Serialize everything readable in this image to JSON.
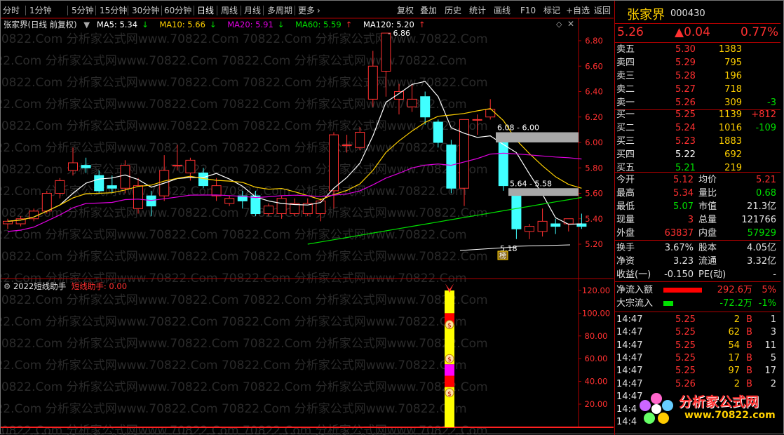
{
  "toolbar": {
    "periods": [
      "分时",
      "1分钟",
      "5分钟",
      "15分钟",
      "30分钟",
      "60分钟",
      "日线",
      "周线",
      "月线",
      "多周期",
      "更多"
    ],
    "active_period": "日线",
    "actions": [
      "复权",
      "叠加",
      "历史",
      "统计",
      "画线",
      "F10",
      "标记",
      "+自选",
      "返回"
    ]
  },
  "main_chart": {
    "title": "张家界(日线 前复权)",
    "ma": [
      {
        "label": "MA5: 5.34",
        "arrow": "↓",
        "color": "#ffffff"
      },
      {
        "label": "MA10: 5.66",
        "arrow": "↓",
        "color": "#ffd000"
      },
      {
        "label": "MA20: 5.91",
        "arrow": "↓",
        "color": "#e000e0"
      },
      {
        "label": "MA60: 5.59",
        "arrow": "↑",
        "color": "#00e000"
      },
      {
        "label": "MA120: 5.20",
        "arrow": "↑",
        "color": "#ffffff"
      }
    ],
    "y_ticks": [
      "6.80",
      "6.60",
      "6.40",
      "6.20",
      "6.00",
      "5.80",
      "5.60",
      "5.40",
      "5.20"
    ],
    "annotations": {
      "high": "6.86",
      "zone1": "6.08 - 6.00",
      "zone2": "5.64 - 5.58",
      "low": "5.18",
      "badge": "榜"
    }
  },
  "sub_chart": {
    "title": "2022短线助手",
    "indicator": "短线助手: 0.00",
    "y_ticks": [
      "120.00",
      "100.00",
      "80.00",
      "60.00",
      "40.00",
      "20.00"
    ]
  },
  "watermark": "70822.Com 分析家公式网www.70822.Com",
  "stock": {
    "name": "张家界",
    "code": "000430",
    "price": "5.26",
    "change": "▲0.04",
    "pct": "0.77%"
  },
  "order_book": {
    "asks": [
      {
        "label": "卖五",
        "price": "5.30",
        "vol": "1383",
        "chg": ""
      },
      {
        "label": "卖四",
        "price": "5.29",
        "vol": "795",
        "chg": ""
      },
      {
        "label": "卖三",
        "price": "5.28",
        "vol": "196",
        "chg": ""
      },
      {
        "label": "卖二",
        "price": "5.27",
        "vol": "718",
        "chg": ""
      },
      {
        "label": "卖一",
        "price": "5.26",
        "vol": "309",
        "chg": "-3"
      }
    ],
    "bids": [
      {
        "label": "买一",
        "price": "5.25",
        "vol": "1139",
        "chg": "+812"
      },
      {
        "label": "买二",
        "price": "5.24",
        "vol": "1016",
        "chg": "-109"
      },
      {
        "label": "买三",
        "price": "5.23",
        "vol": "1883",
        "chg": ""
      },
      {
        "label": "买四",
        "price": "5.22",
        "vol": "692",
        "chg": ""
      },
      {
        "label": "买五",
        "price": "5.21",
        "vol": "219",
        "chg": ""
      }
    ]
  },
  "stats": [
    {
      "l1": "今开",
      "v1": "5.12",
      "l2": "均价",
      "v2": "5.21"
    },
    {
      "l1": "最高",
      "v1": "5.34",
      "l2": "量比",
      "v2": "0.68"
    },
    {
      "l1": "最低",
      "v1": "5.07",
      "l2": "市值",
      "v2": "21.3亿"
    },
    {
      "l1": "现量",
      "v1": "3",
      "l2": "总量",
      "v2": "121766"
    },
    {
      "l1": "外盘",
      "v1": "63837",
      "l2": "内盘",
      "v2": "57929"
    }
  ],
  "stats2": [
    {
      "l1": "换手",
      "v1": "3.67%",
      "l2": "股本",
      "v2": "4.05亿"
    },
    {
      "l1": "净资",
      "v1": "3.23",
      "l2": "流通",
      "v2": "3.32亿"
    },
    {
      "l1": "收益(一)",
      "v1": "-0.150",
      "l2": "PE(动)",
      "v2": "-"
    }
  ],
  "flows": [
    {
      "label": "净流入额",
      "value": "292.6万",
      "pct": "5%"
    },
    {
      "label": "大宗流入",
      "value": "-72.2万",
      "pct": "-1%"
    }
  ],
  "ticks": [
    {
      "time": "14:47",
      "price": "5.25",
      "vol": "2",
      "side": "B",
      "n": "1"
    },
    {
      "time": "14:47",
      "price": "5.25",
      "vol": "62",
      "side": "B",
      "n": "3"
    },
    {
      "time": "14:47",
      "price": "5.25",
      "vol": "54",
      "side": "B",
      "n": "11"
    },
    {
      "time": "14:47",
      "price": "5.25",
      "vol": "17",
      "side": "B",
      "n": "5"
    },
    {
      "time": "14:47",
      "price": "5.25",
      "vol": "97",
      "side": "B",
      "n": "17"
    },
    {
      "time": "14:47",
      "price": "5.26",
      "vol": "2",
      "side": "B",
      "n": "2"
    },
    {
      "time": "14:47",
      "price": "",
      "vol": "",
      "side": "",
      "n": ""
    },
    {
      "time": "14:4",
      "price": "",
      "vol": "",
      "side": "",
      "n": ""
    },
    {
      "time": "14:4",
      "price": "",
      "vol": "",
      "side": "",
      "n": ""
    }
  ],
  "logo": {
    "name": "分析家公式网",
    "url": "www.70822.com"
  },
  "candles": [
    [
      5.36,
      5.38,
      5.32,
      5.4
    ],
    [
      5.36,
      5.4,
      5.34,
      5.42
    ],
    [
      5.4,
      5.46,
      5.38,
      5.48
    ],
    [
      5.46,
      5.6,
      5.44,
      5.62
    ],
    [
      5.6,
      5.7,
      5.56,
      5.72
    ],
    [
      5.78,
      5.84,
      5.74,
      5.96
    ],
    [
      5.82,
      5.8,
      5.76,
      5.88
    ],
    [
      5.74,
      5.62,
      5.6,
      5.78
    ],
    [
      5.66,
      5.64,
      5.6,
      5.74
    ],
    [
      5.64,
      5.82,
      5.6,
      5.86
    ],
    [
      5.48,
      5.66,
      5.44,
      5.72
    ],
    [
      5.58,
      5.5,
      5.42,
      5.62
    ],
    [
      5.58,
      5.78,
      5.54,
      5.9
    ],
    [
      5.82,
      5.82,
      5.78,
      5.98
    ],
    [
      5.76,
      5.86,
      5.7,
      5.88
    ],
    [
      5.76,
      5.66,
      5.64,
      5.8
    ],
    [
      5.58,
      5.66,
      5.54,
      5.72
    ],
    [
      5.52,
      5.56,
      5.5,
      5.58
    ],
    [
      5.58,
      5.54,
      5.48,
      5.62
    ],
    [
      5.58,
      5.44,
      5.42,
      5.62
    ],
    [
      5.44,
      5.5,
      5.42,
      5.52
    ],
    [
      5.44,
      5.56,
      5.4,
      5.58
    ],
    [
      5.44,
      5.52,
      5.42,
      5.56
    ],
    [
      5.44,
      5.52,
      5.42,
      5.56
    ],
    [
      5.44,
      5.54,
      5.38,
      5.56
    ],
    [
      5.62,
      6.06,
      5.48,
      6.08
    ],
    [
      5.98,
      5.98,
      5.92,
      6.06
    ],
    [
      5.96,
      6.08,
      5.94,
      6.12
    ],
    [
      6.34,
      6.6,
      6.28,
      6.72
    ],
    [
      6.56,
      6.86,
      6.36,
      6.86
    ],
    [
      6.34,
      6.4,
      6.22,
      6.46
    ],
    [
      6.28,
      6.34,
      6.24,
      6.46
    ],
    [
      6.36,
      6.2,
      6.14,
      6.4
    ],
    [
      6.16,
      6.0,
      5.96,
      6.18
    ],
    [
      5.98,
      5.64,
      5.6,
      6.02
    ],
    [
      5.64,
      6.18,
      5.5,
      6.18
    ],
    [
      6.18,
      6.18,
      6.06,
      6.22
    ],
    [
      6.2,
      6.26,
      6.18,
      6.34
    ],
    [
      6.0,
      5.66,
      5.62,
      6.0
    ],
    [
      5.6,
      5.32,
      5.24,
      5.6
    ],
    [
      5.3,
      5.34,
      5.24,
      5.36
    ],
    [
      5.3,
      5.38,
      5.26,
      5.48
    ],
    [
      5.36,
      5.34,
      5.28,
      5.4
    ],
    [
      5.36,
      5.4,
      5.3,
      5.4
    ],
    [
      5.36,
      5.34,
      5.32,
      5.44
    ]
  ]
}
